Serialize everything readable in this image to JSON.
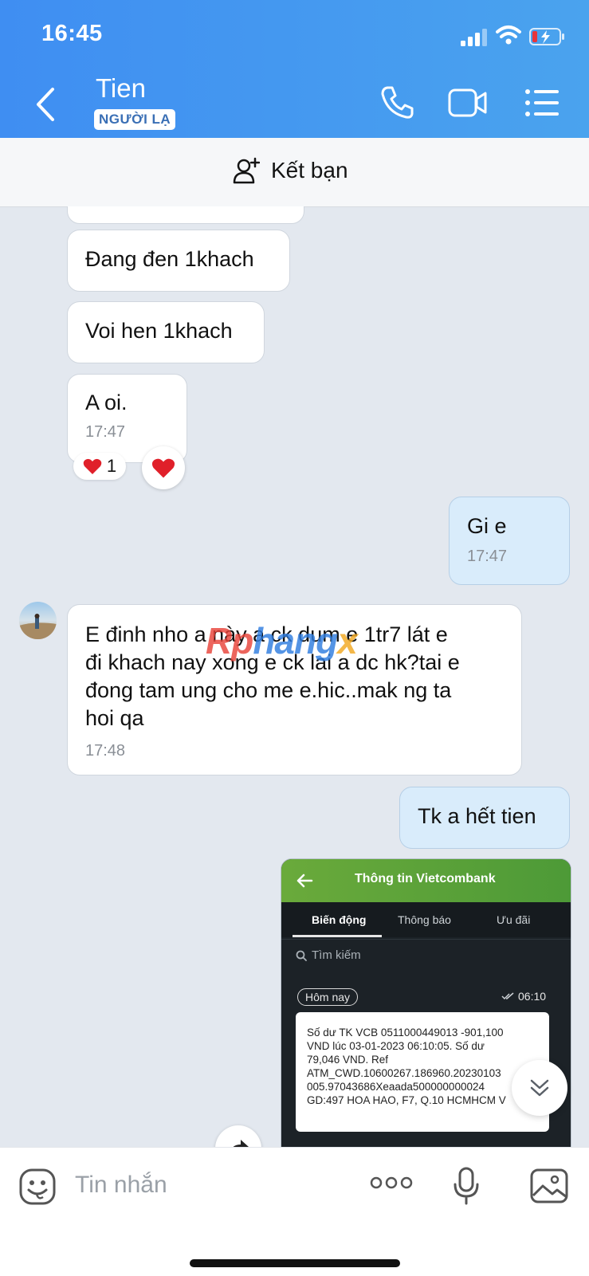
{
  "status_bar": {
    "time": "16:45"
  },
  "header": {
    "contact_name": "Tien",
    "badge": "NGƯỜI LẠ"
  },
  "add_friend": {
    "label": "Kết bạn"
  },
  "messages": [
    {
      "text": "Đang đen 1khach"
    },
    {
      "text": "Voi hen 1khach"
    },
    {
      "text": "A oi.",
      "time": "17:47",
      "reaction_count": "1"
    },
    {
      "text": "Gi e",
      "time": "17:47"
    },
    {
      "lines": [
        "E đinh nho a này a ck dum e 1tr7 lát e",
        "đi khach nay xong e ck lai a dc hk?tai e",
        "đong tam ung cho me e.hic..mak ng ta",
        "hoi qa"
      ],
      "time": "17:48"
    },
    {
      "text": "Tk a hết tien"
    }
  ],
  "watermark": "Rphangx",
  "screenshot": {
    "title": "Thông tin Vietcombank",
    "tabs": [
      "Biến động",
      "Thông báo",
      "Ưu đãi"
    ],
    "search": "Tìm kiếm",
    "date_label": "Hôm nay",
    "time": "06:10",
    "lines": [
      "Số dư TK VCB 0511000449013 -901,100",
      "VND lúc 03-01-2023 06:10:05. Số dư",
      "79,046 VND. Ref",
      "ATM_CWD.10600267.186960.20230103",
      "005.97043686Xeaada500000000024",
      "GD:497 HOA HAO, F7, Q.10 HCMHCM V"
    ]
  },
  "composer": {
    "placeholder": "Tin nhắn"
  },
  "colors": {
    "header": "#4596f0",
    "mine_bubble": "#d9ecfb",
    "background": "#e3e8ef",
    "heart": "#e0202a"
  }
}
